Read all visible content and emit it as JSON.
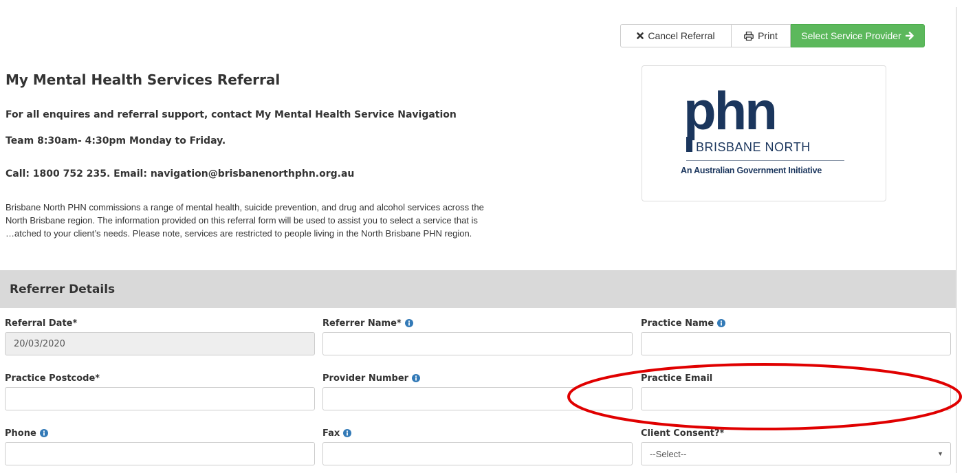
{
  "toolbar": {
    "cancel_label": "Cancel Referral",
    "print_label": "Print",
    "select_provider_label": "Select Service Provider"
  },
  "logo": {
    "wordmark": "phn",
    "region": "BRISBANE NORTH",
    "tagline": "An Australian Government Initiative"
  },
  "header": {
    "title": "My Mental Health Services Referral",
    "contact_line1": "For all enquires and referral support, contact My Mental Health Service Navigation",
    "contact_line2": "Team 8:30am- 4:30pm Monday to Friday.",
    "contact_line3": "Call: 1800 752 235. Email: navigation@brisbanenorthphn.org.au"
  },
  "intro": {
    "line1": "Brisbane North PHN commissions a range of mental health, suicide prevention, and drug and alcohol services across the",
    "line2": "North Brisbane region.  The information provided on this referral form will be used to assist you to select a service that is",
    "line3": "…atched to your client’s needs.  Please note, services are restricted to people living in the North Brisbane PHN region."
  },
  "section": {
    "title": "Referrer Details"
  },
  "fields": {
    "referral_date": {
      "label": "Referral Date*",
      "value": "20/03/2020"
    },
    "referrer_name": {
      "label": "Referrer Name*",
      "value": ""
    },
    "practice_name": {
      "label": "Practice Name",
      "value": ""
    },
    "practice_postcode": {
      "label": "Practice Postcode*",
      "value": ""
    },
    "provider_number": {
      "label": "Provider Number",
      "value": ""
    },
    "practice_email": {
      "label": "Practice Email",
      "value": ""
    },
    "phone": {
      "label": "Phone",
      "value": ""
    },
    "fax": {
      "label": "Fax",
      "value": ""
    },
    "client_consent": {
      "label": "Client Consent?*",
      "selected": "--Select--"
    }
  },
  "colors": {
    "success": "#5cb85c",
    "brand_navy": "#1b365d",
    "info_blue": "#337ab7",
    "annotation_red": "#e00000",
    "section_bg": "#d9d9d9"
  },
  "icons": {
    "cancel": "times-icon",
    "print": "print-icon",
    "arrow": "arrow-right-icon",
    "info": "info-circle-icon",
    "dropdown": "caret-down-icon"
  }
}
